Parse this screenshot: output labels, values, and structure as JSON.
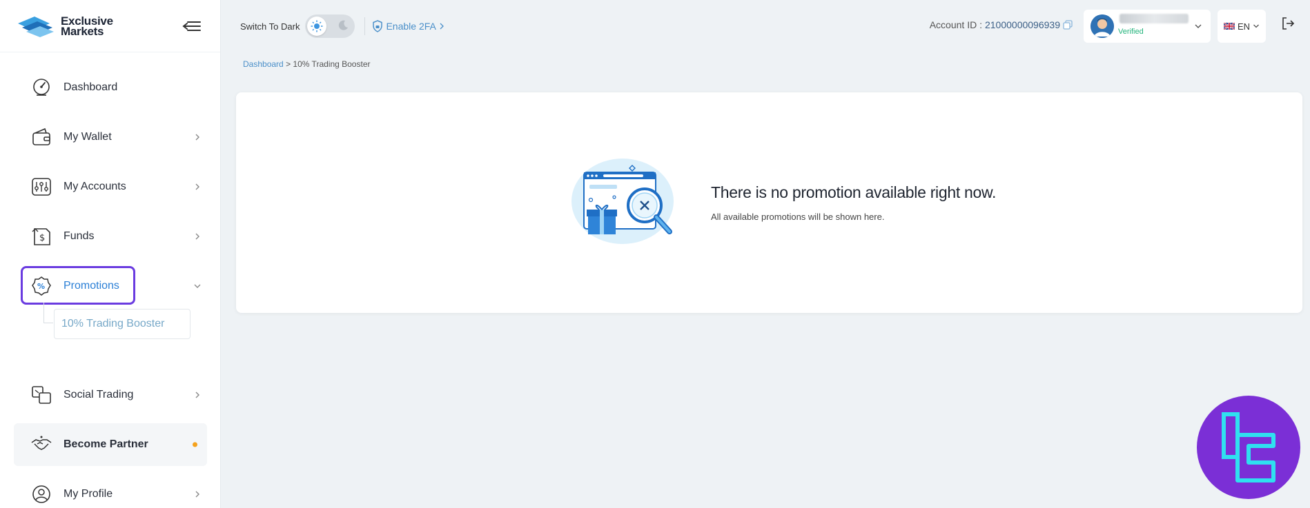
{
  "brand": {
    "line1": "Exclusive",
    "line2": "Markets"
  },
  "topbar": {
    "dark_mode_label": "Switch To Dark",
    "twofa_label": "Enable 2FA",
    "account_id_label": "Account ID :",
    "account_id_value": "21000000096939",
    "user_status": "Verified",
    "language": "EN"
  },
  "sidebar": {
    "items": [
      {
        "label": "Dashboard"
      },
      {
        "label": "My Wallet"
      },
      {
        "label": "My Accounts"
      },
      {
        "label": "Funds"
      },
      {
        "label": "Promotions"
      },
      {
        "label": "Social Trading"
      },
      {
        "label": "Become Partner"
      },
      {
        "label": "My Profile"
      }
    ],
    "promotions_sub": "10% Trading Booster"
  },
  "breadcrumb": {
    "root": "Dashboard",
    "separator": ">",
    "current": "10% Trading Booster"
  },
  "empty_state": {
    "title": "There is no promotion available right now.",
    "subtitle": "All available promotions will be shown here."
  },
  "colors": {
    "accent": "#2a7fd6",
    "highlight": "#6a3be0",
    "verified": "#21b37a",
    "partner_dot": "#f5a21c"
  }
}
